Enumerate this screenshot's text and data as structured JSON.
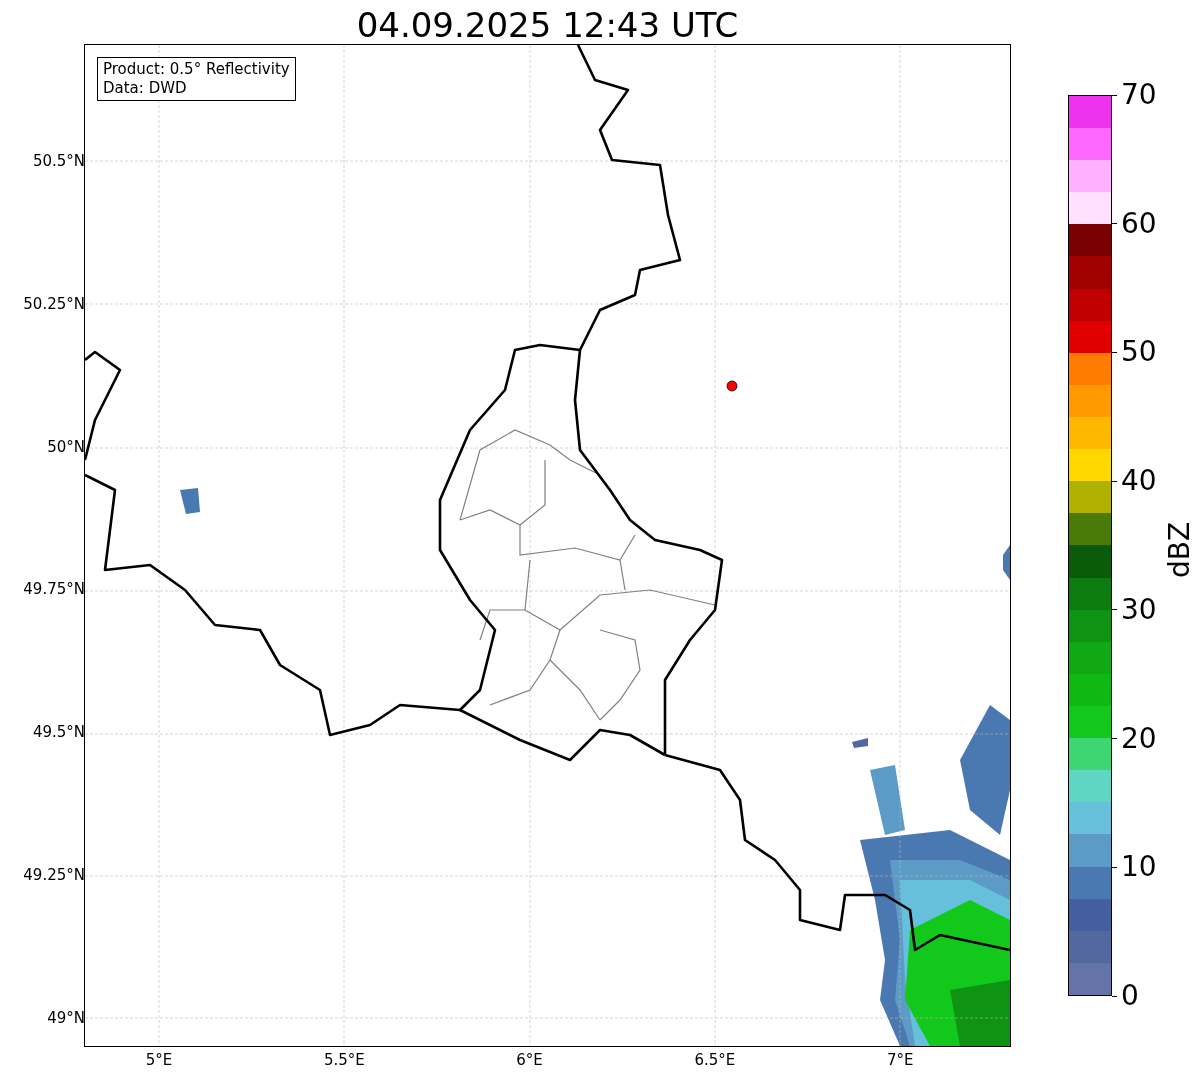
{
  "title": "04.09.2025 12:43 UTC",
  "info_box": {
    "lines": [
      "Product: 0.5° Reflectivity",
      "Data: DWD"
    ]
  },
  "map": {
    "y_ticks": [
      "50.5°N",
      "50.25°N",
      "50°N",
      "49.75°N",
      "49.5°N",
      "49.25°N",
      "49°N"
    ],
    "x_ticks": [
      "5°E",
      "5.5°E",
      "6°E",
      "6.5°E",
      "7°E"
    ]
  },
  "colorbar": {
    "label": "dBZ",
    "ticks": [
      "70",
      "60",
      "50",
      "40",
      "30",
      "20",
      "10",
      "0"
    ],
    "bands": [
      {
        "color": "#6473a8"
      },
      {
        "color": "#5468a0"
      },
      {
        "color": "#445ea0"
      },
      {
        "color": "#4a78b0"
      },
      {
        "color": "#5b9bc6"
      },
      {
        "color": "#66c0dc"
      },
      {
        "color": "#5ed6c2"
      },
      {
        "color": "#3dd672"
      },
      {
        "color": "#12c81a"
      },
      {
        "color": "#10b814"
      },
      {
        "color": "#10a814"
      },
      {
        "color": "#0e9412"
      },
      {
        "color": "#0c7c10"
      },
      {
        "color": "#0a5c0a"
      },
      {
        "color": "#4a7a0a"
      },
      {
        "color": "#b0b000"
      },
      {
        "color": "#ffd800"
      },
      {
        "color": "#ffb800"
      },
      {
        "color": "#ff9a00"
      },
      {
        "color": "#ff7c00"
      },
      {
        "color": "#e00000"
      },
      {
        "color": "#c00000"
      },
      {
        "color": "#a00000"
      },
      {
        "color": "#780000"
      },
      {
        "color": "#ffe0ff"
      },
      {
        "color": "#ffb0ff"
      },
      {
        "color": "#ff66ff"
      },
      {
        "color": "#ee33ee"
      }
    ]
  }
}
